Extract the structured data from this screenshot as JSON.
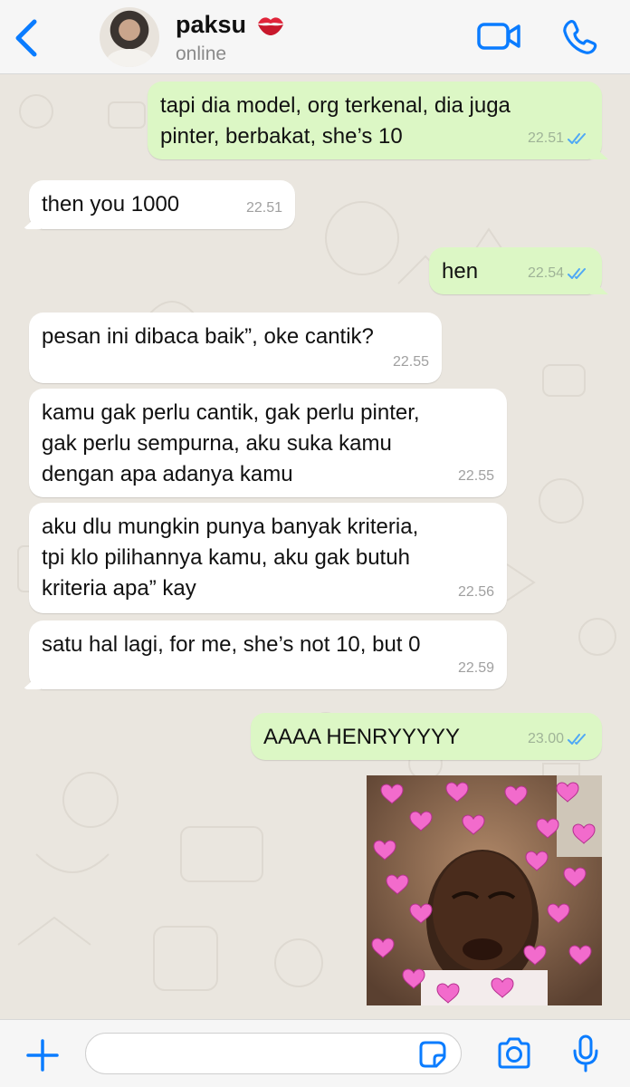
{
  "header": {
    "name": "paksu",
    "status": "online",
    "name_emoji": "kiss-mark-icon"
  },
  "messages": [
    {
      "dir": "out",
      "text": "tapi dia model, org terkenal, dia juga\npinter, berbakat, she’s 10",
      "time": "22.51",
      "read": true
    },
    {
      "dir": "in",
      "text": "then you 1000",
      "time": "22.51"
    },
    {
      "dir": "out",
      "text": "hen",
      "time": "22.54",
      "read": true
    },
    {
      "dir": "in",
      "text": "pesan ini dibaca baik”, oke cantik?",
      "time": "22.55"
    },
    {
      "dir": "in",
      "text": "kamu gak perlu cantik, gak perlu pinter,\ngak perlu sempurna, aku suka kamu\ndengan apa adanya kamu",
      "time": "22.55"
    },
    {
      "dir": "in",
      "text": "aku dlu mungkin punya banyak kriteria,\ntpi klo pilihannya kamu, aku gak butuh\nkriteria apa” kay",
      "time": "22.56"
    },
    {
      "dir": "in",
      "text": "satu hal lagi, for me, she’s not 10, but 0",
      "time": "22.59"
    },
    {
      "dir": "out",
      "text": "AAAA HENRYYYYY",
      "time": "23.00",
      "read": true
    }
  ],
  "composer": {
    "placeholder": ""
  },
  "colors": {
    "accent": "#0a7cff",
    "outgoing": "#dcf7c5",
    "incoming": "#ffffff",
    "read_ticks": "#4fa8f5",
    "heart": "#f26bcc"
  }
}
